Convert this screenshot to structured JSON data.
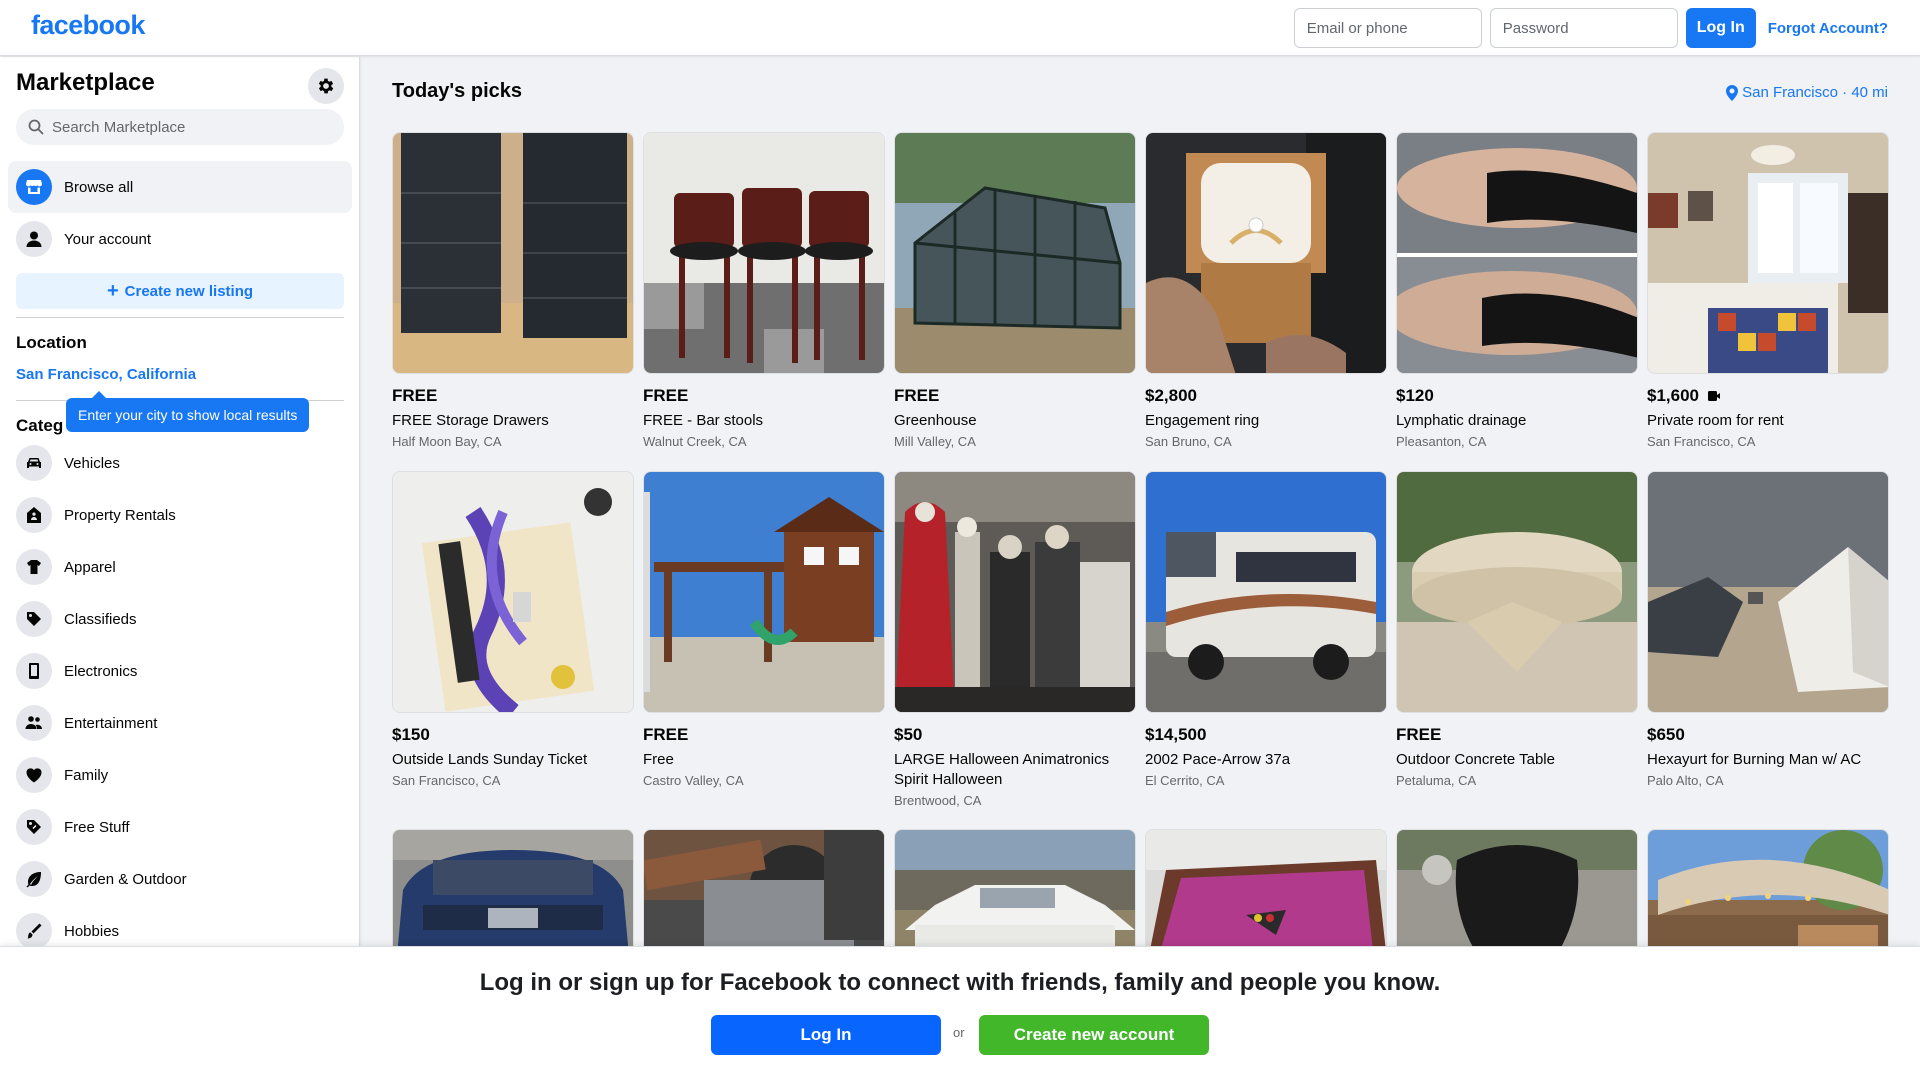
{
  "header": {
    "logo": "facebook",
    "email_placeholder": "Email or phone",
    "password_placeholder": "Password",
    "login_label": "Log In",
    "forgot_label": "Forgot Account?"
  },
  "sidebar": {
    "title": "Marketplace",
    "search_placeholder": "Search Marketplace",
    "browse_all": "Browse all",
    "your_account": "Your account",
    "create_listing": "Create new listing",
    "location_heading": "Location",
    "location_value": "San Francisco, California",
    "tooltip": "Enter your city to show local results",
    "categories_heading": "Categ",
    "categories": [
      {
        "label": "Vehicles",
        "icon": "car-icon"
      },
      {
        "label": "Property Rentals",
        "icon": "house-icon"
      },
      {
        "label": "Apparel",
        "icon": "shirt-icon"
      },
      {
        "label": "Classifieds",
        "icon": "tag-icon"
      },
      {
        "label": "Electronics",
        "icon": "phone-icon"
      },
      {
        "label": "Entertainment",
        "icon": "people-icon"
      },
      {
        "label": "Family",
        "icon": "heart-icon"
      },
      {
        "label": "Free Stuff",
        "icon": "free-tag-icon"
      },
      {
        "label": "Garden & Outdoor",
        "icon": "leaf-icon"
      },
      {
        "label": "Hobbies",
        "icon": "brush-icon"
      }
    ]
  },
  "main": {
    "title": "Today's picks",
    "location_filter": "San Francisco · 40 mi",
    "listings": [
      {
        "price": "FREE",
        "title": "FREE Storage Drawers",
        "location": "Half Moon Bay, CA"
      },
      {
        "price": "FREE",
        "title": "FREE - Bar stools",
        "location": "Walnut Creek, CA"
      },
      {
        "price": "FREE",
        "title": "Greenhouse",
        "location": "Mill Valley, CA"
      },
      {
        "price": "$2,800",
        "title": "Engagement ring",
        "location": "San Bruno, CA"
      },
      {
        "price": "$120",
        "title": "Lymphatic drainage",
        "location": "Pleasanton, CA"
      },
      {
        "price": "$1,600",
        "title": "Private room for rent",
        "location": "San Francisco, CA"
      },
      {
        "price": "$150",
        "title": "Outside Lands Sunday Ticket",
        "location": "San Francisco, CA"
      },
      {
        "price": "FREE",
        "title": "Free",
        "location": "Castro Valley, CA"
      },
      {
        "price": "$50",
        "title": "LARGE Halloween Animatronics Spirit Halloween",
        "location": "Brentwood, CA"
      },
      {
        "price": "$14,500",
        "title": "2002 Pace-Arrow 37a",
        "location": "El Cerrito, CA"
      },
      {
        "price": "FREE",
        "title": "Outdoor Concrete Table",
        "location": "Petaluma, CA"
      },
      {
        "price": "$650",
        "title": "Hexayurt for Burning Man w/ AC",
        "location": "Palo Alto, CA"
      }
    ]
  },
  "banner": {
    "text": "Log in or sign up for Facebook to connect with friends, family and people you know.",
    "login_label": "Log In",
    "or_label": "or",
    "create_label": "Create new account"
  },
  "colors": {
    "brand": "#1877f2",
    "login_blue": "#0866ff",
    "create_green": "#42b72a",
    "background": "#f0f2f5"
  }
}
